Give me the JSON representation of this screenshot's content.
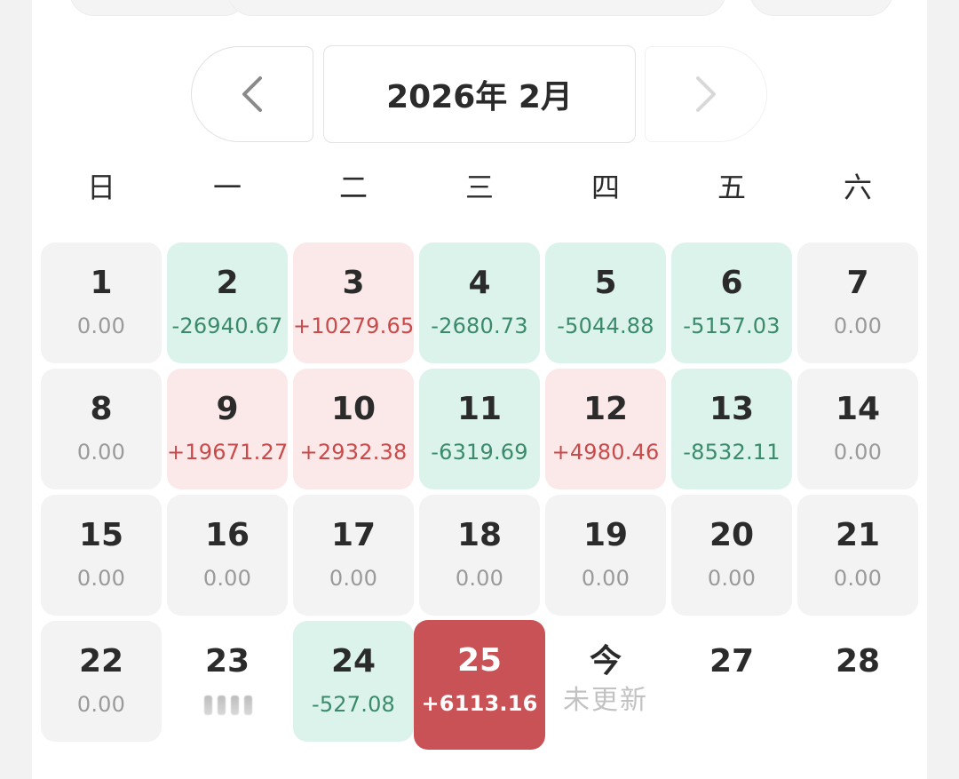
{
  "header": {
    "month_title": "2026年 2月",
    "prev_icon": "chevron-left-icon",
    "next_icon": "chevron-right-icon"
  },
  "weekdays": [
    "日",
    "一",
    "二",
    "三",
    "四",
    "五",
    "六"
  ],
  "colors": {
    "gain_bg": "#fbe8e8",
    "gain_text": "#c94a4a",
    "loss_bg": "#dcf3eb",
    "loss_text": "#3b8a6b",
    "neutral_bg": "#f3f3f3",
    "selected_bg": "#c95257"
  },
  "days": [
    {
      "day": "1",
      "value": "0.00",
      "status": "neutral"
    },
    {
      "day": "2",
      "value": "-26940.67",
      "status": "loss"
    },
    {
      "day": "3",
      "value": "+10279.65",
      "status": "gain"
    },
    {
      "day": "4",
      "value": "-2680.73",
      "status": "loss"
    },
    {
      "day": "5",
      "value": "-5044.88",
      "status": "loss"
    },
    {
      "day": "6",
      "value": "-5157.03",
      "status": "loss"
    },
    {
      "day": "7",
      "value": "0.00",
      "status": "neutral"
    },
    {
      "day": "8",
      "value": "0.00",
      "status": "neutral"
    },
    {
      "day": "9",
      "value": "+19671.27",
      "status": "gain"
    },
    {
      "day": "10",
      "value": "+2932.38",
      "status": "gain"
    },
    {
      "day": "11",
      "value": "-6319.69",
      "status": "loss"
    },
    {
      "day": "12",
      "value": "+4980.46",
      "status": "gain"
    },
    {
      "day": "13",
      "value": "-8532.11",
      "status": "loss"
    },
    {
      "day": "14",
      "value": "0.00",
      "status": "neutral"
    },
    {
      "day": "15",
      "value": "0.00",
      "status": "neutral"
    },
    {
      "day": "16",
      "value": "0.00",
      "status": "neutral"
    },
    {
      "day": "17",
      "value": "0.00",
      "status": "neutral"
    },
    {
      "day": "18",
      "value": "0.00",
      "status": "neutral"
    },
    {
      "day": "19",
      "value": "0.00",
      "status": "neutral"
    },
    {
      "day": "20",
      "value": "0.00",
      "status": "neutral"
    },
    {
      "day": "21",
      "value": "0.00",
      "status": "neutral"
    },
    {
      "day": "22",
      "value": "0.00",
      "status": "neutral"
    },
    {
      "day": "23",
      "value": "",
      "status": "masked"
    },
    {
      "day": "24",
      "value": "-527.08",
      "status": "loss"
    },
    {
      "day": "25",
      "value": "+6113.16",
      "status": "selected"
    },
    {
      "day": "今",
      "value": "未更新",
      "status": "today"
    },
    {
      "day": "27",
      "value": "",
      "status": "empty"
    },
    {
      "day": "28",
      "value": "",
      "status": "empty"
    }
  ]
}
